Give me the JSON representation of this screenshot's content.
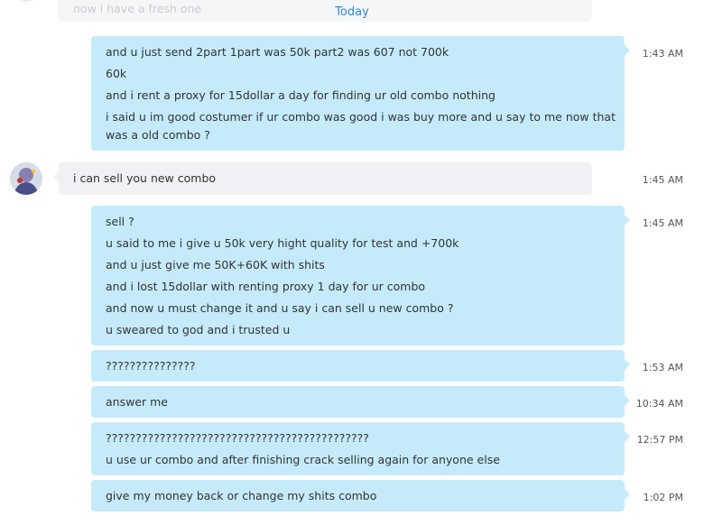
{
  "previous_message": {
    "text": "now i have a fresh one"
  },
  "divider": {
    "label": "Today"
  },
  "messages": [
    {
      "sender": "me",
      "time": "1:43 AM",
      "lines": [
        "and u just send 2part 1part was 50k part2 was 607 not 700k",
        "60k",
        "and i rent a proxy for 15dollar a day for finding ur old combo nothing",
        "i said u im good costumer if ur combo was good i was buy  more and u say to me now that",
        "was a old combo ?"
      ]
    },
    {
      "sender": "them",
      "time": "1:45 AM",
      "lines": [
        "i can sell you new combo"
      ]
    },
    {
      "sender": "me",
      "time": "1:45 AM",
      "lines": [
        "sell ?",
        "u said to me i give u 50k very hight quality for test and +700k",
        "and u just give me 50K+60K with shits",
        "and i lost 15dollar with renting proxy 1 day for ur combo",
        "and now u must change it and u say i can sell u new combo ?",
        "u sweared to god and i trusted u"
      ]
    },
    {
      "sender": "me",
      "time": "1:53 AM",
      "lines": [
        "???????????????"
      ]
    },
    {
      "sender": "me",
      "time": "10:34 AM",
      "lines": [
        "answer me"
      ]
    },
    {
      "sender": "me",
      "time": "12:57 PM",
      "lines": [
        "????????????????????????????????????????????",
        "u use ur combo and after finishing crack selling again for anyone else"
      ]
    },
    {
      "sender": "me",
      "time": "1:02 PM",
      "lines": [
        "give my money back or change my shits combo"
      ]
    }
  ]
}
